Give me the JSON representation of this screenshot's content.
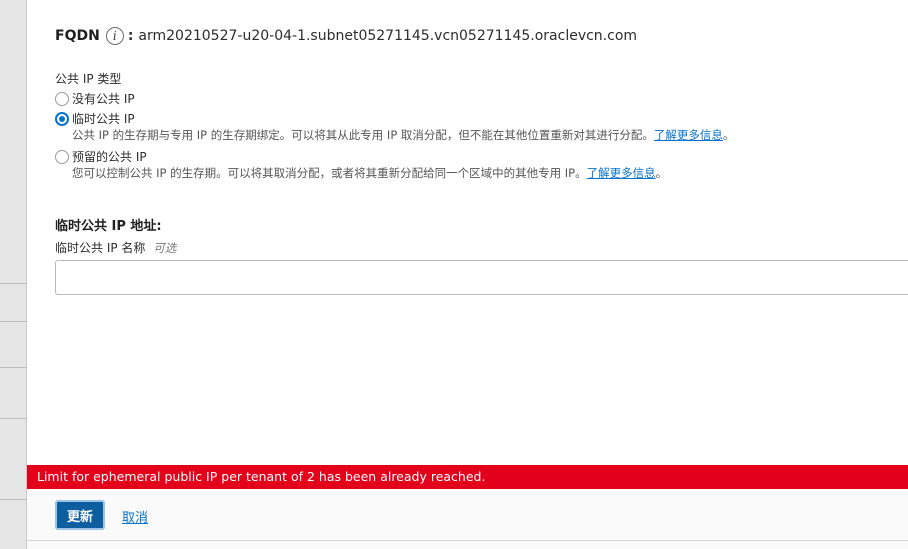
{
  "fqdn": {
    "label": "FQDN",
    "info_icon": "info-icon",
    "info_glyph": "i",
    "colon": ":",
    "value": "arm20210527-u20-04-1.subnet05271145.vcn05271145.oraclevcn.com"
  },
  "public_ip_type": {
    "label": "公共 IP 类型",
    "options": [
      {
        "label": "没有公共 IP",
        "checked": false,
        "description": "",
        "link": ""
      },
      {
        "label": "临时公共 IP",
        "checked": true,
        "description": "公共 IP 的生存期与专用 IP 的生存期绑定。可以将其从此专用 IP 取消分配，但不能在其他位置重新对其进行分配。",
        "link": "了解更多信息",
        "after_link": "。"
      },
      {
        "label": "预留的公共 IP",
        "checked": false,
        "description": "您可以控制公共 IP 的生存期。可以将其取消分配，或者将其重新分配给同一个区域中的其他专用 IP。",
        "link": "了解更多信息",
        "after_link": "。"
      }
    ]
  },
  "ephemeral_address": {
    "heading": "临时公共 IP 地址:",
    "name_label": "临时公共 IP 名称",
    "optional": "可选",
    "name_value": ""
  },
  "error_message": "Limit for ephemeral public IP per tenant of 2 has been already reached.",
  "footer": {
    "update_button": "更新",
    "cancel_link": "取消"
  },
  "colors": {
    "accent": "#0572ce",
    "primary_button": "#0d5e9e",
    "error": "#e2001a"
  }
}
